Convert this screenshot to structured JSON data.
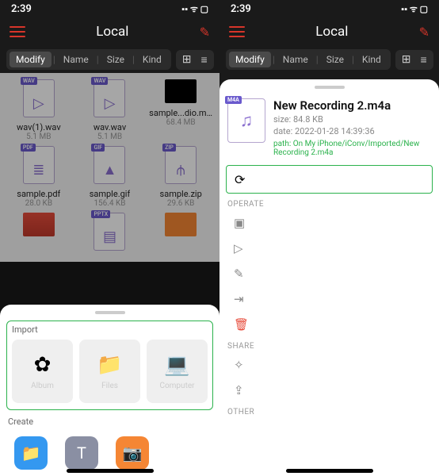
{
  "statusbar": {
    "time": "2:39",
    "indicators": "▪︎▪︎ ᯤ ▢"
  },
  "header": {
    "title": "Local"
  },
  "filterbar": {
    "modify": "Modify",
    "name": "Name",
    "size": "Size",
    "kind": "Kind"
  },
  "files": [
    {
      "tag": "WAV",
      "glyph": "▷",
      "name": "wav(1).wav",
      "size": "5.1 MB"
    },
    {
      "tag": "WAV",
      "glyph": "▷",
      "name": "wav.wav",
      "size": "5.1 MB"
    },
    {
      "thumb": true,
      "name": "sample...dio.mov",
      "size": "68.4 MB"
    },
    {
      "tag": "PDF",
      "glyph": "≣",
      "name": "sample.pdf",
      "size": "28.0 KB"
    },
    {
      "tag": "GIF",
      "glyph": "▲",
      "name": "sample.gif",
      "size": "156.4 KB"
    },
    {
      "tag": "ZIP",
      "glyph": "⫛",
      "name": "sample.zip",
      "size": "29.6 KB"
    }
  ],
  "truncated": [
    {
      "thumbClass": "red",
      "name": ""
    },
    {
      "tag": "PPTX",
      "glyph": "▤",
      "name": ""
    },
    {
      "thumbClass": "orange",
      "name": ""
    }
  ],
  "sheet": {
    "import_label": "Import",
    "import": [
      {
        "icon": "✿",
        "label": "Album"
      },
      {
        "icon": "📁",
        "label": "Files"
      },
      {
        "icon": "💻",
        "label": "Computer"
      }
    ],
    "create_label": "Create",
    "create": [
      {
        "icon": "📁",
        "cls": "blue"
      },
      {
        "icon": "T",
        "cls": "gray"
      },
      {
        "icon": "📷",
        "cls": "orange"
      }
    ]
  },
  "detail": {
    "tag": "M4A",
    "name": "New Recording 2.m4a",
    "size": "size: 84.8 KB",
    "date": "date: 2022-01-28 14:39:36",
    "path": "path: On My iPhone/iConv/Imported/New Recording 2.m4a",
    "convert_icon": "⟳",
    "operate_label": "OPERATE",
    "operate": [
      {
        "icon": "▣"
      },
      {
        "icon": "▷"
      },
      {
        "icon": "✎"
      },
      {
        "icon": "⇥"
      },
      {
        "icon": "🗑",
        "red": true
      }
    ],
    "share_label": "SHARE",
    "share": [
      {
        "icon": "✧"
      },
      {
        "icon": "⇪"
      }
    ],
    "other_label": "OTHER"
  }
}
